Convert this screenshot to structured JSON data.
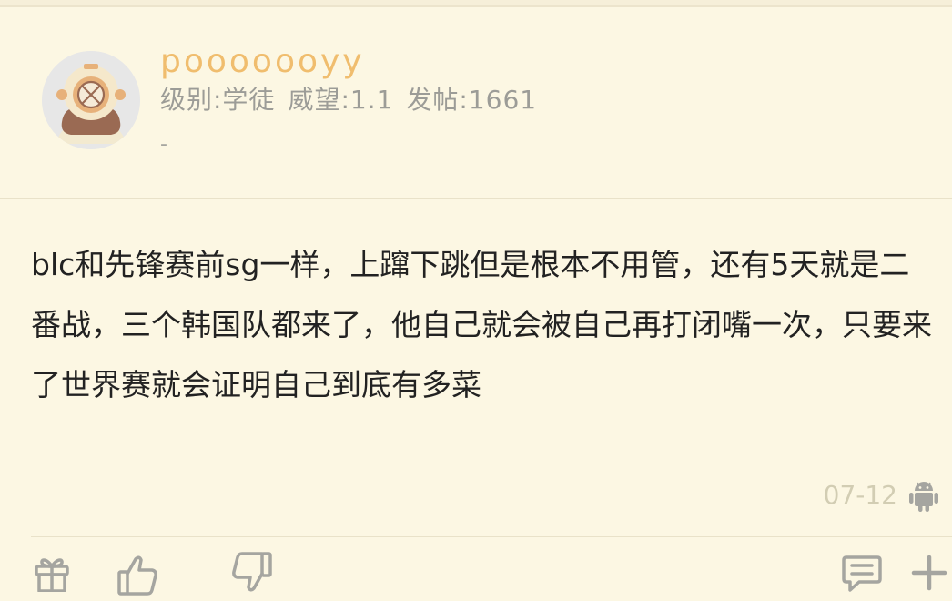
{
  "post": {
    "username": "pooooooyy",
    "level": "级别:学徒",
    "reputation": "威望:1.1",
    "posts": "发帖:1661",
    "signature": "-",
    "content": "blc和先锋赛前sg一样，上蹿下跳但是根本不用管，还有5天就是二番战，三个韩国队都来了，他自己就会被自己再打闭嘴一次，只要来了世界赛就会证明自己到底有多菜",
    "time": "07-12",
    "device_icon": "android-icon"
  },
  "actions": {
    "left": [
      "gift-icon",
      "thumbs-up-icon",
      "thumbs-down-icon"
    ],
    "right": [
      "comment-icon",
      "plus-icon"
    ]
  },
  "colors": {
    "background": "#fcf7e3",
    "username": "#f0bd6e",
    "meta": "#9c9c97",
    "content": "#222222",
    "time": "#d2cdb3",
    "icon": "#a5a5a0"
  }
}
